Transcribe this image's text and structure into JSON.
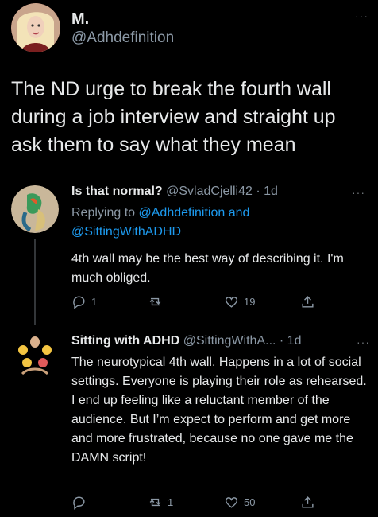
{
  "main_tweet": {
    "author_name": "M.",
    "author_handle": "@Adhdefinition",
    "text": "The ND urge to break the fourth wall during a job interview and straight up ask them to say what they mean",
    "more": "···"
  },
  "reply1": {
    "author_name": "Is that normal?",
    "author_handle": "@SvladCjelli42",
    "time": "· 1d",
    "replying_prefix": "Replying to",
    "replying_handle1": "@Adhdefinition",
    "replying_and": "and",
    "replying_handle2": "@SittingWithADHD",
    "text": "4th wall may be the best way of describing it. I'm much obliged.",
    "reply_count": "1",
    "retweet_count": "",
    "like_count": "19",
    "more": "···"
  },
  "reply2": {
    "author_name": "Sitting with ADHD",
    "author_handle": "@SittingWithA...",
    "time": "· 1d",
    "text": "The neurotypical 4th wall. Happens in a lot of social settings. Everyone is playing their role as rehearsed. I end up feeling like a reluctant member of the audience. But I’m expect to perform and get more and more frustrated, because no one gave me the DAMN script!",
    "reply_count": "",
    "retweet_count": "1",
    "like_count": "50",
    "more": "···"
  },
  "icons": [
    "reply-icon",
    "retweet-icon",
    "like-icon",
    "share-icon"
  ],
  "colors": {
    "background": "#000000",
    "text": "#e7e9ea",
    "muted": "#8b98a5",
    "link": "#1d9bf0"
  }
}
